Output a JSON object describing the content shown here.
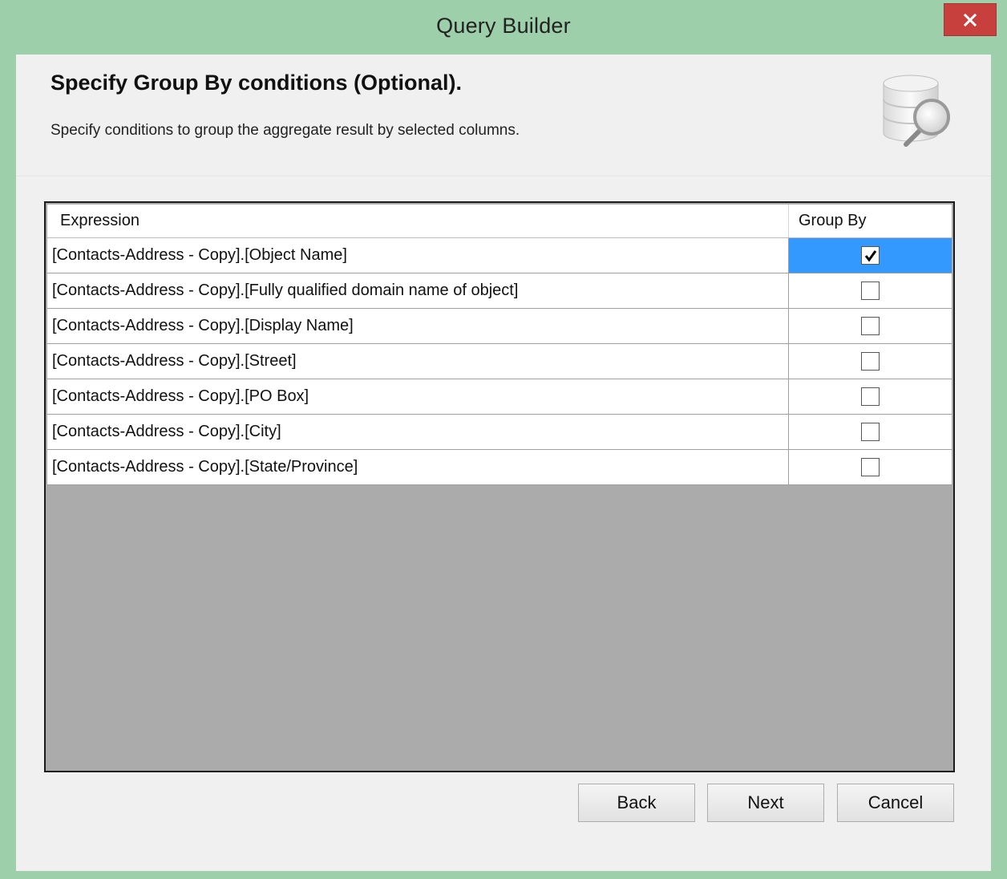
{
  "window": {
    "title": "Query Builder",
    "close_icon": "close-icon"
  },
  "header": {
    "heading": "Specify Group By conditions (Optional).",
    "subheading": "Specify conditions to group the aggregate result by selected columns.",
    "icon": "database-search-icon"
  },
  "grid": {
    "columns": [
      "Expression",
      "Group By"
    ],
    "rows": [
      {
        "expression": "[Contacts-Address - Copy].[Object Name]",
        "group_by": true,
        "selected": true
      },
      {
        "expression": "[Contacts-Address - Copy].[Fully qualified domain name of object]",
        "group_by": false
      },
      {
        "expression": "[Contacts-Address - Copy].[Display Name]",
        "group_by": false
      },
      {
        "expression": "[Contacts-Address - Copy].[Street]",
        "group_by": false
      },
      {
        "expression": "[Contacts-Address - Copy].[PO Box]",
        "group_by": false
      },
      {
        "expression": "[Contacts-Address - Copy].[City]",
        "group_by": false
      },
      {
        "expression": "[Contacts-Address - Copy].[State/Province]",
        "group_by": false
      }
    ]
  },
  "buttons": {
    "back": "Back",
    "next": "Next",
    "cancel": "Cancel"
  },
  "colors": {
    "frame": "#9dcfaa",
    "close": "#c8403d",
    "selection": "#3399ff"
  }
}
